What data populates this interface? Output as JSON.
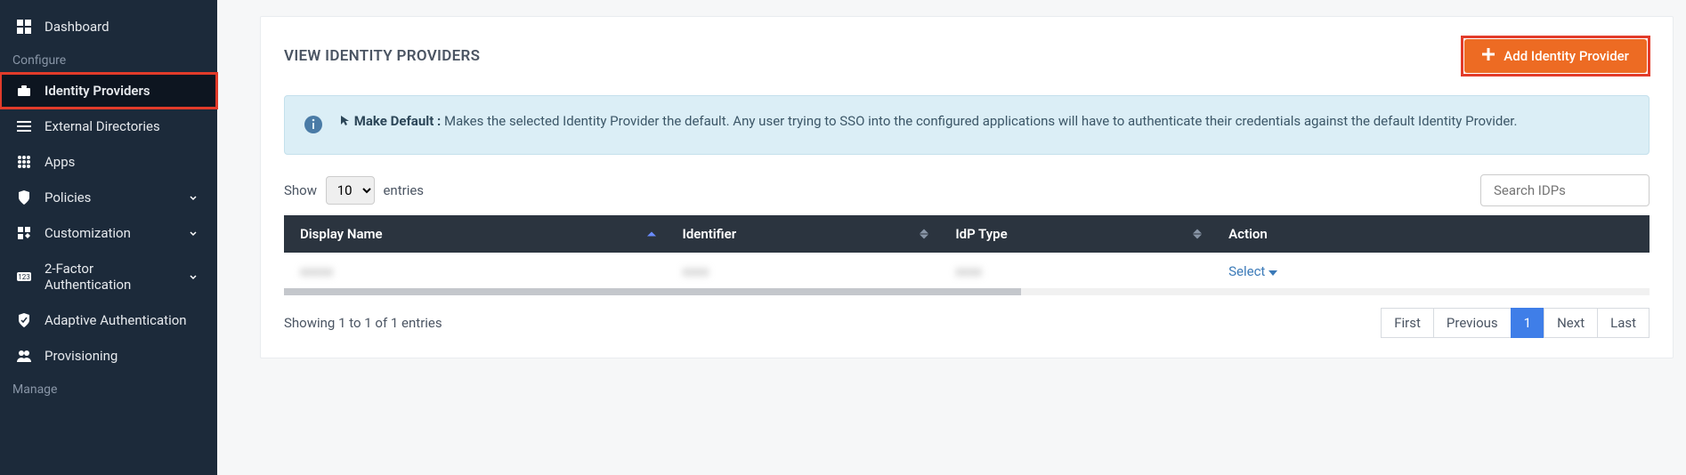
{
  "sidebar": {
    "items": [
      {
        "label": "Dashboard"
      },
      {
        "label": "Identity Providers"
      },
      {
        "label": "External Directories"
      },
      {
        "label": "Apps"
      },
      {
        "label": "Policies"
      },
      {
        "label": "Customization"
      },
      {
        "label": "2-Factor Authentication"
      },
      {
        "label": "Adaptive Authentication"
      },
      {
        "label": "Provisioning"
      }
    ],
    "section_configure": "Configure",
    "section_manage": "Manage"
  },
  "header": {
    "title": "VIEW IDENTITY PROVIDERS",
    "add_button": "Add Identity Provider"
  },
  "info": {
    "lead": "Make Default :",
    "body": "Makes the selected Identity Provider the default. Any user trying to SSO into the configured applications will have to authenticate their credentials against the default Identity Provider."
  },
  "table_controls": {
    "show_label": "Show",
    "entries_label": "entries",
    "page_size": "10",
    "search_placeholder": "Search IDPs"
  },
  "table": {
    "columns": [
      "Display Name",
      "Identifier",
      "IdP Type",
      "Action"
    ],
    "rows": [
      {
        "display_name": "xxxxx",
        "identifier": "xxxx",
        "idp_type": "xxxx",
        "action": "Select"
      }
    ]
  },
  "table_footer": {
    "summary": "Showing 1 to 1 of 1 entries",
    "first": "First",
    "prev": "Previous",
    "page": "1",
    "next": "Next",
    "last": "Last"
  }
}
